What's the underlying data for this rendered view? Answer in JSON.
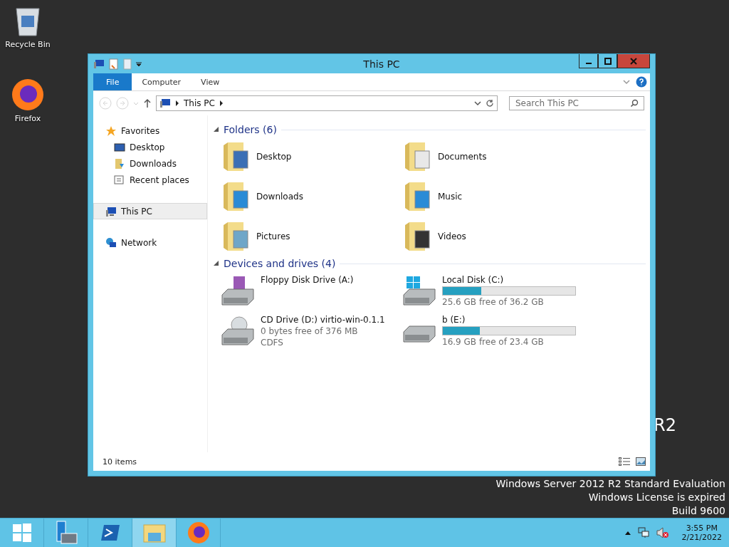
{
  "desktop_icons": [
    {
      "label": "Recycle Bin",
      "kind": "recycle"
    },
    {
      "label": "Firefox",
      "kind": "firefox"
    }
  ],
  "window": {
    "title": "This PC"
  },
  "ribbon_tabs": [
    {
      "label": "File",
      "kind": "file"
    },
    {
      "label": "Computer",
      "kind": "tab"
    },
    {
      "label": "View",
      "kind": "tab"
    }
  ],
  "address": {
    "path": [
      "This PC"
    ]
  },
  "search": {
    "placeholder": "Search This PC"
  },
  "nav": [
    {
      "label": "Favorites",
      "kind": "star",
      "selected": false,
      "children": [
        {
          "label": "Desktop",
          "kind": "desktop",
          "selected": false
        },
        {
          "label": "Downloads",
          "kind": "downloads",
          "selected": false
        },
        {
          "label": "Recent places",
          "kind": "recent",
          "selected": false
        }
      ]
    },
    {
      "label": "This PC",
      "kind": "pc",
      "selected": true
    },
    {
      "label": "Network",
      "kind": "network",
      "selected": false
    }
  ],
  "folders": {
    "title": "Folders (6)",
    "items": [
      {
        "name": "Desktop",
        "kind": "desktop"
      },
      {
        "name": "Documents",
        "kind": "documents"
      },
      {
        "name": "Downloads",
        "kind": "downloads"
      },
      {
        "name": "Music",
        "kind": "music"
      },
      {
        "name": "Pictures",
        "kind": "pictures"
      },
      {
        "name": "Videos",
        "kind": "videos"
      }
    ]
  },
  "drives": {
    "title": "Devices and drives (4)",
    "items": [
      {
        "name": "Floppy Disk Drive (A:)",
        "kind": "floppy"
      },
      {
        "name": "Local Disk (C:)",
        "kind": "system",
        "level": 0.29,
        "space": "25.6 GB free of 36.2 GB"
      },
      {
        "name": "CD Drive (D:) virtio-win-0.1.1",
        "kind": "cd",
        "space": "0 bytes free of 376 MB",
        "filesystem": "CDFS"
      },
      {
        "name": "b (E:)",
        "kind": "disk",
        "level": 0.28,
        "space": "16.9 GB free of 23.4 GB"
      }
    ]
  },
  "status_bar": {
    "count": "10 items"
  },
  "watermark": {
    "edition_mark": "R2",
    "lines": [
      "Windows Server 2012 R2 Standard Evaluation",
      "Windows License is expired",
      "Build 9600"
    ]
  },
  "taskbar": {
    "apps": [
      {
        "kind": "start",
        "selected": false
      },
      {
        "kind": "server",
        "selected": false
      },
      {
        "kind": "shell",
        "selected": false
      },
      {
        "kind": "explorer",
        "selected": true
      },
      {
        "kind": "firefox",
        "selected": false
      }
    ],
    "time": "3:55 PM",
    "date": "2/21/2022"
  }
}
